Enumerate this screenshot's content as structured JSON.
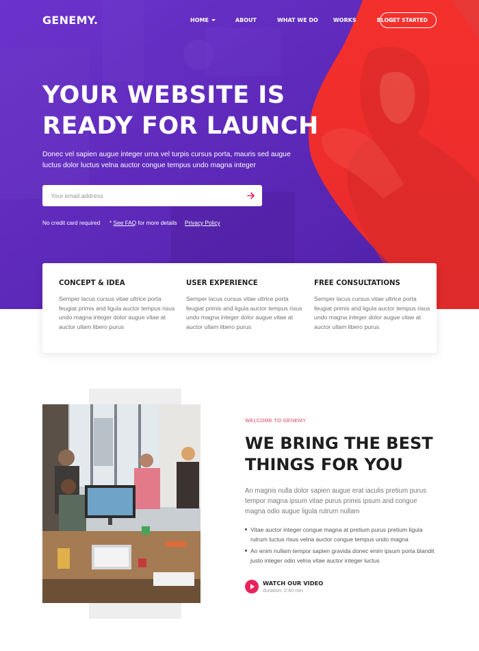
{
  "header": {
    "logo": "GENEMY.",
    "nav": [
      "HOME",
      "ABOUT",
      "WHAT WE DO",
      "WORKS",
      "BLOG"
    ],
    "cta": "GET STARTED"
  },
  "hero": {
    "headline_line1": "YOUR WEBSITE IS",
    "headline_line2": "READY FOR LAUNCH",
    "text": "Donec vel sapien augue integer urna vel turpis cursus porta, mauris sed augue luctus dolor luctus velna auctor congue tempus undo magna integer",
    "email_placeholder": "Your email address",
    "note_no_card": "No credit card required",
    "note_star": "* ",
    "note_faq": "See FAQ",
    "note_details": " for more details",
    "note_privacy": "Privacy Policy"
  },
  "features": [
    {
      "title": "CONCEPT & IDEA",
      "text": "Semper lacus cursus vitae ultrice porta feugiat primis and ligula auctor tempus risus undo magna integer dolor augue vitae at auctor ullam libero purus"
    },
    {
      "title": "USER EXPERIENCE",
      "text": "Semper lacus cursus vitae ultrice porta feugiat primis and ligula auctor tempus risus undo magna integer dolor augue vitae at auctor ullam libero purus"
    },
    {
      "title": "FREE CONSULTATIONS",
      "text": "Semper lacus cursus vitae ultrice porta feugiat primis and ligula auctor tempus risus undo magna integer dolor augue vitae at auctor ullam libero purus"
    }
  ],
  "about": {
    "welcome": "WELCOME TO GENEMY",
    "title_line1": "WE BRING THE BEST",
    "title_line2": "THINGS FOR YOU",
    "text": "An magnis nulla dolor sapien augue erat iaculis pretium purus tempor magna ipsum vitae purus primis ipsum and congue magna odio augue ligula rutrum nullam",
    "bullets": [
      "Vitae auctor integer congue magna at pretium purus pretium ligula rutrum luctus risus velna auctor congue tempus undo magna",
      "An enim nullam tempor sapien gravida donec enim ipsum porta blandit justo integer odio velna vitae auctor integer luctus"
    ],
    "video_label": "WATCH OUR VIDEO",
    "video_duration": "duration: 2:40 min"
  },
  "colors": {
    "hero_purple": "#5a26b8",
    "hero_red": "#f0302e",
    "accent_pink": "#e8245a"
  }
}
